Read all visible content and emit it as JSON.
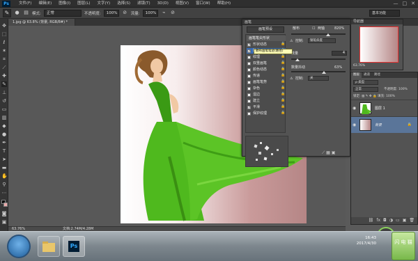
{
  "app": {
    "logo": "Ps"
  },
  "menu": [
    "文件(F)",
    "编辑(E)",
    "图像(I)",
    "图层(L)",
    "文字(Y)",
    "选择(S)",
    "滤镜(T)",
    "3D(D)",
    "视图(V)",
    "窗口(W)",
    "帮助(H)"
  ],
  "window_controls": [
    "—",
    "□",
    "✕"
  ],
  "options": {
    "mode_label": "模式:",
    "mode_value": "正常",
    "opacity_label": "不透明度:",
    "opacity_value": "100%",
    "flow_label": "流量:",
    "flow_value": "100%",
    "workspace": "基本功能"
  },
  "document_tab": "1.jpg @ 63.8% (背景, RGB/8#) *",
  "status": {
    "zoom": "63.76%",
    "doc": "文档:2.74M/4.28M"
  },
  "brush_panel": {
    "title": "画笔",
    "preset_button": "画笔预设",
    "list": [
      {
        "label": "画笔笔尖形状",
        "checked": null,
        "header": true
      },
      {
        "label": "形状动态",
        "checked": true
      },
      {
        "label": "散布",
        "checked": true,
        "selected": true
      },
      {
        "label": "纹理",
        "checked": false
      },
      {
        "label": "双重画笔",
        "checked": false
      },
      {
        "label": "颜色动态",
        "checked": false
      },
      {
        "label": "传递",
        "checked": false
      },
      {
        "label": "画笔笔势",
        "checked": false
      },
      {
        "label": "杂色",
        "checked": false
      },
      {
        "label": "湿边",
        "checked": false
      },
      {
        "label": "建立",
        "checked": false
      },
      {
        "label": "平滑",
        "checked": true
      },
      {
        "label": "保护纹理",
        "checked": false
      }
    ],
    "scatter_label": "散布",
    "both_axes_label": "两轴",
    "scatter_value": "820%",
    "control_label": "控制:",
    "control_value": "钢笔斜度",
    "count_label": "数量",
    "count_value": "4",
    "count_jitter_label": "数量抖动",
    "count_jitter_value": "63%",
    "control2_value": "关",
    "tooltip": "散布画笔笔迹(路径)"
  },
  "navigator": {
    "title": "导航器",
    "zoom": "63.76%"
  },
  "layers": {
    "tabs": [
      "图层",
      "通道",
      "路径"
    ],
    "filter": "ρ 类型",
    "blend": "正常",
    "opacity_label": "不透明度:",
    "opacity_value": "100%",
    "lock_label": "锁定:",
    "fill_label": "填充:",
    "fill_value": "100%",
    "items": [
      {
        "name": "图层 1",
        "selected": false
      },
      {
        "name": "背景",
        "selected": true,
        "locked": true
      }
    ]
  },
  "perf_value": "59",
  "taskbar": {
    "apps": [
      "文件夹",
      "Photoshop"
    ],
    "time": "16:43",
    "date": "2017/4/30",
    "tray_logo": "闪 电 猫"
  }
}
